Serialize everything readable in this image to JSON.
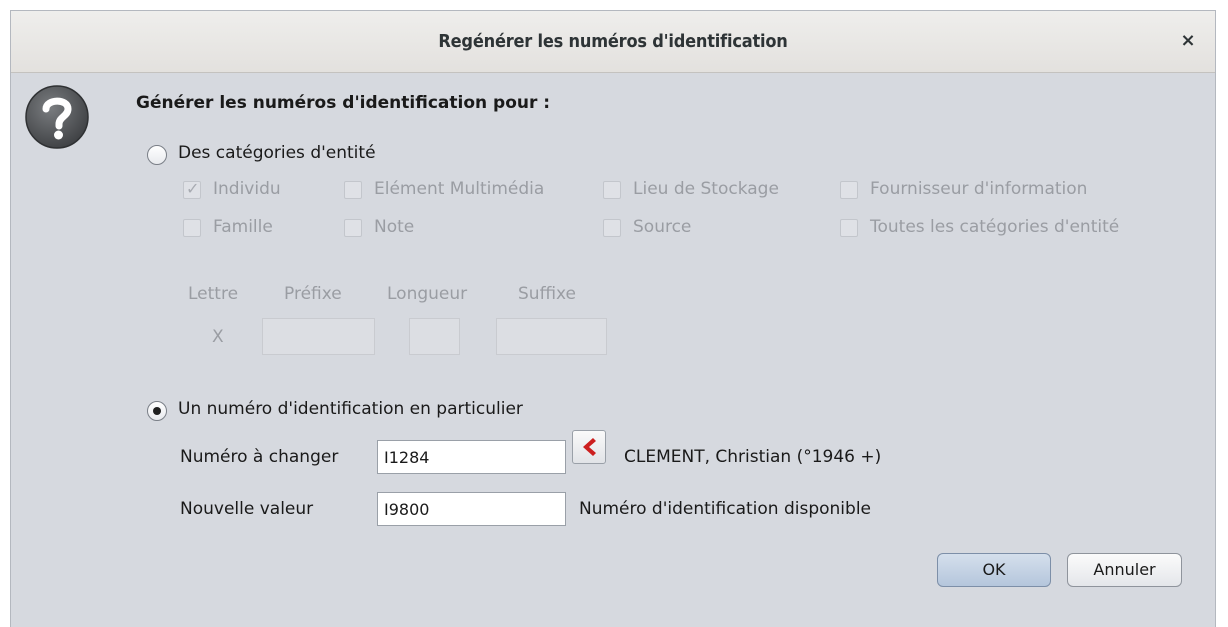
{
  "dialog": {
    "title": "Regénérer les numéros d'identification",
    "close_glyph": "×"
  },
  "heading": "Générer les numéros d'identification pour :",
  "option_categories": {
    "label": "Des catégories d'entité",
    "selected": false,
    "checkboxes": [
      {
        "label": "Individu",
        "checked": true
      },
      {
        "label": "Elément Multimédia",
        "checked": false
      },
      {
        "label": "Lieu de Stockage",
        "checked": false
      },
      {
        "label": "Fournisseur d'information",
        "checked": false
      },
      {
        "label": "Famille",
        "checked": false
      },
      {
        "label": "Note",
        "checked": false
      },
      {
        "label": "Source",
        "checked": false
      },
      {
        "label": "Toutes les catégories d'entité",
        "checked": false
      }
    ],
    "format": {
      "letter_header": "Lettre",
      "prefix_header": "Préfixe",
      "length_header": "Longueur",
      "suffix_header": "Suffixe",
      "letter_value": "X",
      "prefix_value": "",
      "length_value": "",
      "suffix_value": ""
    }
  },
  "option_single": {
    "label": "Un numéro d'identification en particulier",
    "selected": true,
    "number_to_change_label": "Numéro à changer",
    "number_to_change_value": "I1284",
    "entity_description": "CLEMENT, Christian (°1946 +)",
    "new_value_label": "Nouvelle valeur",
    "new_value": "I9800",
    "status": "Numéro d'identification disponible"
  },
  "buttons": {
    "ok": "OK",
    "cancel": "Annuler"
  },
  "icons": {
    "dialog": "question-icon",
    "picker": "back-arrow-icon"
  },
  "colors": {
    "dialog_bg": "#d6d9df",
    "ok_button": "#b5c6dc",
    "picker_arrow": "#cc1f1f"
  }
}
